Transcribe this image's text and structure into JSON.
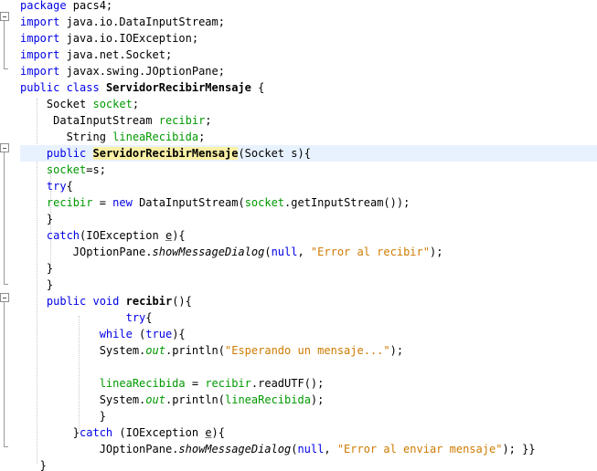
{
  "editor": {
    "colors": {
      "keyword": "#0000e6",
      "field": "#009900",
      "string": "#ce7b00",
      "current_line": "#e8f2fe",
      "occurrence_highlight": "#faf1a6"
    },
    "lines": [
      {
        "tokens": [
          {
            "t": "package",
            "c": "kw"
          },
          {
            "t": " pacs4;"
          }
        ]
      },
      {
        "tokens": [
          {
            "t": "import",
            "c": "kw"
          },
          {
            "t": " java.io.DataInputStream;"
          }
        ]
      },
      {
        "tokens": [
          {
            "t": "import",
            "c": "kw"
          },
          {
            "t": " java.io.IOException;"
          }
        ]
      },
      {
        "tokens": [
          {
            "t": "import",
            "c": "kw"
          },
          {
            "t": " java.net.Socket;"
          }
        ]
      },
      {
        "tokens": [
          {
            "t": "import",
            "c": "kw"
          },
          {
            "t": " javax.swing.JOptionPane;"
          }
        ]
      },
      {
        "tokens": [
          {
            "t": "public class",
            "c": "kw"
          },
          {
            "t": " "
          },
          {
            "t": "ServidorRecibirMensaje",
            "c": "b"
          },
          {
            "t": " {"
          }
        ]
      },
      {
        "tokens": [
          {
            "t": "    Socket "
          },
          {
            "t": "socket",
            "c": "fld"
          },
          {
            "t": ";"
          }
        ]
      },
      {
        "tokens": [
          {
            "t": "     DataInputStream "
          },
          {
            "t": "recibir",
            "c": "fld"
          },
          {
            "t": ";"
          }
        ]
      },
      {
        "tokens": [
          {
            "t": "       String "
          },
          {
            "t": "lineaRecibida",
            "c": "fld"
          },
          {
            "t": ";"
          }
        ]
      },
      {
        "hl": true,
        "tokens": [
          {
            "t": "    "
          },
          {
            "t": "public",
            "c": "kw"
          },
          {
            "t": " "
          },
          {
            "t": "ServidorRecibirMensaje",
            "c": "b mark"
          },
          {
            "t": "(Socket s){"
          }
        ]
      },
      {
        "tokens": [
          {
            "t": "    "
          },
          {
            "t": "socket",
            "c": "fld"
          },
          {
            "t": "=s;"
          }
        ]
      },
      {
        "tokens": [
          {
            "t": "    "
          },
          {
            "t": "try",
            "c": "kw"
          },
          {
            "t": "{"
          }
        ]
      },
      {
        "tokens": [
          {
            "t": "    "
          },
          {
            "t": "recibir",
            "c": "fld"
          },
          {
            "t": " = "
          },
          {
            "t": "new",
            "c": "kw"
          },
          {
            "t": " DataInputStream("
          },
          {
            "t": "socket",
            "c": "fld"
          },
          {
            "t": ".getInputStream());"
          }
        ]
      },
      {
        "tokens": [
          {
            "t": "    }"
          }
        ]
      },
      {
        "tokens": [
          {
            "t": "    "
          },
          {
            "t": "catch",
            "c": "kw"
          },
          {
            "t": "(IOException "
          },
          {
            "t": "e",
            "c": "ul"
          },
          {
            "t": "){"
          }
        ]
      },
      {
        "tokens": [
          {
            "t": "        JOptionPane."
          },
          {
            "t": "showMessageDialog",
            "c": "it"
          },
          {
            "t": "("
          },
          {
            "t": "null",
            "c": "kw"
          },
          {
            "t": ", "
          },
          {
            "t": "\"Error al recibir\"",
            "c": "str"
          },
          {
            "t": ");"
          }
        ]
      },
      {
        "tokens": [
          {
            "t": "    }"
          }
        ]
      },
      {
        "tokens": [
          {
            "t": "    }"
          }
        ]
      },
      {
        "tokens": [
          {
            "t": "    "
          },
          {
            "t": "public void",
            "c": "kw"
          },
          {
            "t": " "
          },
          {
            "t": "recibir",
            "c": "b"
          },
          {
            "t": "(){"
          }
        ]
      },
      {
        "tokens": [
          {
            "t": "                "
          },
          {
            "t": "try",
            "c": "kw"
          },
          {
            "t": "{"
          }
        ]
      },
      {
        "tokens": [
          {
            "t": "            "
          },
          {
            "t": "while",
            "c": "kw"
          },
          {
            "t": " ("
          },
          {
            "t": "true",
            "c": "kw"
          },
          {
            "t": "){"
          }
        ]
      },
      {
        "tokens": [
          {
            "t": "            System."
          },
          {
            "t": "out",
            "c": "fld it"
          },
          {
            "t": ".println("
          },
          {
            "t": "\"Esperando un mensaje...\"",
            "c": "str"
          },
          {
            "t": ");"
          }
        ]
      },
      {
        "tokens": [
          {
            "t": ""
          }
        ]
      },
      {
        "tokens": [
          {
            "t": "            "
          },
          {
            "t": "lineaRecibida",
            "c": "fld"
          },
          {
            "t": " = "
          },
          {
            "t": "recibir",
            "c": "fld"
          },
          {
            "t": ".readUTF();"
          }
        ]
      },
      {
        "tokens": [
          {
            "t": "            System."
          },
          {
            "t": "out",
            "c": "fld it"
          },
          {
            "t": ".println("
          },
          {
            "t": "lineaRecibida",
            "c": "fld"
          },
          {
            "t": ");"
          }
        ]
      },
      {
        "tokens": [
          {
            "t": "            }"
          }
        ]
      },
      {
        "tokens": [
          {
            "t": "        }"
          },
          {
            "t": "catch",
            "c": "kw"
          },
          {
            "t": " (IOException "
          },
          {
            "t": "e",
            "c": "ul"
          },
          {
            "t": "){"
          }
        ]
      },
      {
        "tokens": [
          {
            "t": "            JOptionPane."
          },
          {
            "t": "showMessageDialog",
            "c": "it"
          },
          {
            "t": "("
          },
          {
            "t": "null",
            "c": "kw"
          },
          {
            "t": ", "
          },
          {
            "t": "\"Error al enviar mensaje\"",
            "c": "str"
          },
          {
            "t": "); }}"
          }
        ]
      },
      {
        "tokens": [
          {
            "t": "   }"
          }
        ]
      }
    ]
  }
}
